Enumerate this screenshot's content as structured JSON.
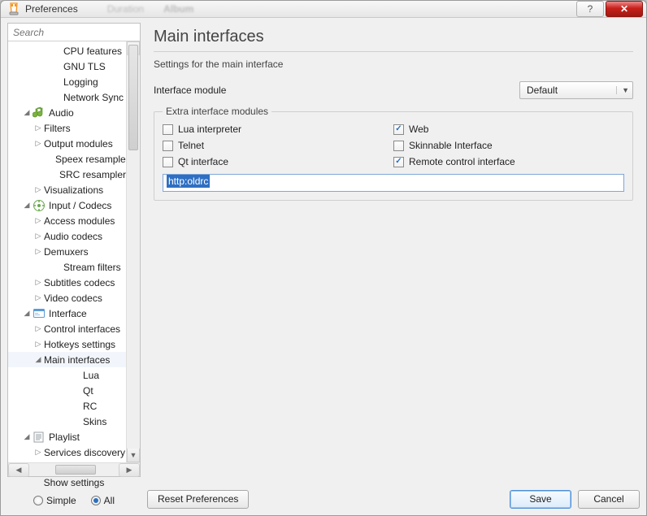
{
  "window": {
    "title": "Preferences",
    "blurred1": "Duration",
    "blurred2": "Album",
    "help_glyph": "?",
    "close_glyph": "✕"
  },
  "sidebar": {
    "search_placeholder": "Search",
    "items": [
      {
        "label": "CPU features",
        "type": "leaf",
        "indent": "indent3"
      },
      {
        "label": "GNU TLS",
        "type": "leaf",
        "indent": "indent3"
      },
      {
        "label": "Logging",
        "type": "leaf",
        "indent": "indent3"
      },
      {
        "label": "Network Sync",
        "type": "leaf",
        "indent": "indent3"
      },
      {
        "label": "Audio",
        "type": "branch",
        "indent": "indent1",
        "state": "open",
        "icon": "audio"
      },
      {
        "label": "Filters",
        "type": "branch",
        "indent": "indent2",
        "state": "closed"
      },
      {
        "label": "Output modules",
        "type": "branch",
        "indent": "indent2",
        "state": "closed"
      },
      {
        "label": "Speex resampler",
        "type": "leaf",
        "indent": "indent3"
      },
      {
        "label": "SRC resampler",
        "type": "leaf",
        "indent": "indent3"
      },
      {
        "label": "Visualizations",
        "type": "branch",
        "indent": "indent2",
        "state": "closed"
      },
      {
        "label": "Input / Codecs",
        "type": "branch",
        "indent": "indent1",
        "state": "open",
        "icon": "input"
      },
      {
        "label": "Access modules",
        "type": "branch",
        "indent": "indent2",
        "state": "closed"
      },
      {
        "label": "Audio codecs",
        "type": "branch",
        "indent": "indent2",
        "state": "closed"
      },
      {
        "label": "Demuxers",
        "type": "branch",
        "indent": "indent2",
        "state": "closed"
      },
      {
        "label": "Stream filters",
        "type": "leaf",
        "indent": "indent3"
      },
      {
        "label": "Subtitles codecs",
        "type": "branch",
        "indent": "indent2",
        "state": "closed"
      },
      {
        "label": "Video codecs",
        "type": "branch",
        "indent": "indent2",
        "state": "closed"
      },
      {
        "label": "Interface",
        "type": "branch",
        "indent": "indent1",
        "state": "open",
        "icon": "interface"
      },
      {
        "label": "Control interfaces",
        "type": "branch",
        "indent": "indent2",
        "state": "closed"
      },
      {
        "label": "Hotkeys settings",
        "type": "branch",
        "indent": "indent2",
        "state": "closed"
      },
      {
        "label": "Main interfaces",
        "type": "branch",
        "indent": "indent2",
        "state": "open",
        "selected": true
      },
      {
        "label": "Lua",
        "type": "leaf",
        "indent": "indent3b"
      },
      {
        "label": "Qt",
        "type": "leaf",
        "indent": "indent3b"
      },
      {
        "label": "RC",
        "type": "leaf",
        "indent": "indent3b"
      },
      {
        "label": "Skins",
        "type": "leaf",
        "indent": "indent3b"
      },
      {
        "label": "Playlist",
        "type": "branch",
        "indent": "indent1",
        "state": "open",
        "icon": "playlist"
      },
      {
        "label": "Services discovery",
        "type": "branch",
        "indent": "indent2",
        "state": "closed"
      }
    ]
  },
  "content": {
    "title": "Main interfaces",
    "subtitle": "Settings for the main interface",
    "module_label": "Interface module",
    "module_value": "Default",
    "group_legend": "Extra interface modules",
    "checks": [
      {
        "label": "Lua interpreter",
        "checked": false
      },
      {
        "label": "Web",
        "checked": true
      },
      {
        "label": "Telnet",
        "checked": false
      },
      {
        "label": "Skinnable Interface",
        "checked": false
      },
      {
        "label": "Qt interface",
        "checked": false
      },
      {
        "label": "Remote control interface",
        "checked": true
      }
    ],
    "text_value": "http:oldrc"
  },
  "footer": {
    "show_settings_label": "Show settings",
    "radio_simple": "Simple",
    "radio_all": "All",
    "reset": "Reset Preferences",
    "save": "Save",
    "cancel": "Cancel"
  }
}
